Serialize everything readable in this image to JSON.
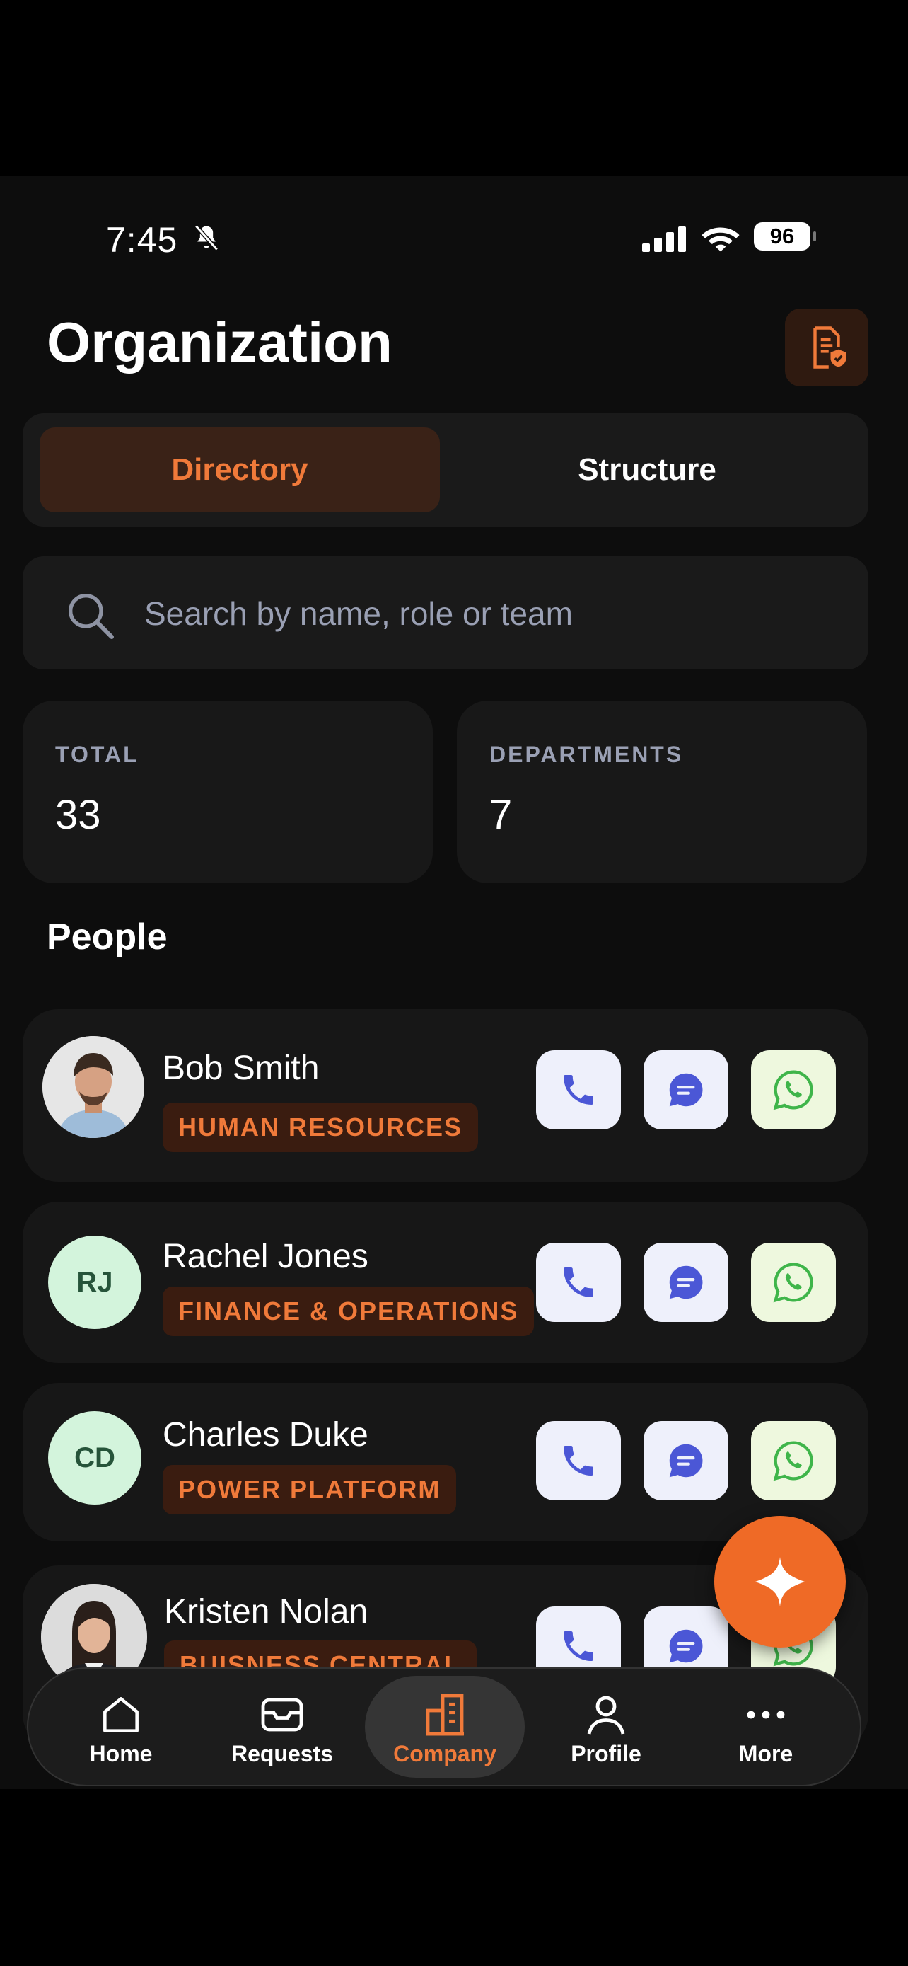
{
  "status_bar": {
    "time": "7:45",
    "battery": "96",
    "icons": [
      "bell-slash-icon",
      "signal-icon",
      "wifi-icon",
      "battery-icon"
    ]
  },
  "header": {
    "title": "Organization",
    "action_icon": "document-shield-icon"
  },
  "tabs": [
    {
      "label": "Directory",
      "selected": true
    },
    {
      "label": "Structure",
      "selected": false
    }
  ],
  "search": {
    "placeholder": "Search by name, role or team",
    "value": ""
  },
  "stats": [
    {
      "label": "TOTAL",
      "value": "33"
    },
    {
      "label": "DEPARTMENTS",
      "value": "7"
    }
  ],
  "section_title": "People",
  "people": [
    {
      "name": "Bob Smith",
      "department": "HUMAN RESOURCES",
      "avatar": "photo"
    },
    {
      "name": "Rachel Jones",
      "department": "FINANCE & OPERATIONS",
      "initials": "RJ"
    },
    {
      "name": "Charles Duke",
      "department": "POWER PLATFORM",
      "initials": "CD"
    },
    {
      "name": "Kristen Nolan",
      "department": "BUISNESS CENTRAL",
      "avatar": "photo"
    }
  ],
  "actions": [
    "phone-icon",
    "message-icon",
    "whatsapp-icon"
  ],
  "fab": {
    "icon": "sparkle-icon"
  },
  "nav": [
    {
      "label": "Home",
      "icon": "home-icon",
      "active": false
    },
    {
      "label": "Requests",
      "icon": "inbox-icon",
      "active": false
    },
    {
      "label": "Company",
      "icon": "building-icon",
      "active": true
    },
    {
      "label": "Profile",
      "icon": "person-icon",
      "active": false
    },
    {
      "label": "More",
      "icon": "more-icon",
      "active": false
    }
  ],
  "colors": {
    "accent": "#ef6a26",
    "background": "#0d0d0d",
    "card": "#171717",
    "initials_bg": "#d3f4dc"
  }
}
